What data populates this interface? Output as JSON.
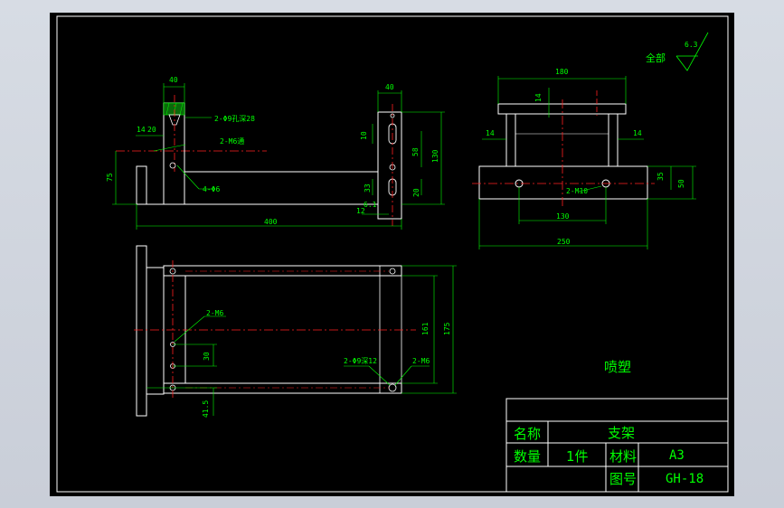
{
  "surface_finish": {
    "prefix": "全部",
    "value": "6.3"
  },
  "coating_note": "喷塑",
  "title_block": {
    "name_label": "名称",
    "name_value": "支架",
    "qty_label": "数量",
    "qty_value": "1件",
    "material_label": "材料",
    "material_value": "A3",
    "drawing_no_label": "图号",
    "drawing_no_value": "GH-18"
  },
  "side_view": {
    "dims": {
      "top_width": "40",
      "hole_note": "2-Φ9孔深28",
      "thread_note": "2-M6通",
      "left_14": "14",
      "left_20": "20",
      "height_75": "75",
      "holes_4": "4-Φ6",
      "overall_length": "400",
      "right_width": "40",
      "slot_10": "10",
      "slot_58": "58",
      "slot_130": "130",
      "slot_33": "33",
      "slot_20": "20",
      "offset_12": "12",
      "offset_6_1": "6.1"
    }
  },
  "end_view": {
    "dims": {
      "top_width": "180",
      "tab_14": "14",
      "left_14": "14",
      "right_14": "14",
      "base_35": "35",
      "base_50": "50",
      "thread_note": "2-M10",
      "hole_spacing": "130",
      "base_width": "250"
    }
  },
  "top_view": {
    "dims": {
      "thread_note": "2-M6",
      "spacing_30": "30",
      "spacing_41_5": "41.5",
      "inner_161": "161",
      "outer_175": "175",
      "hole_note": "2-Φ9深12",
      "thread_note_right": "2-M6"
    }
  },
  "colors": {
    "background": "#000000",
    "geometry": "#ffffff",
    "dimensions": "#00ff00",
    "centerlines": "#ff2020",
    "accent": "#ff00ff"
  }
}
